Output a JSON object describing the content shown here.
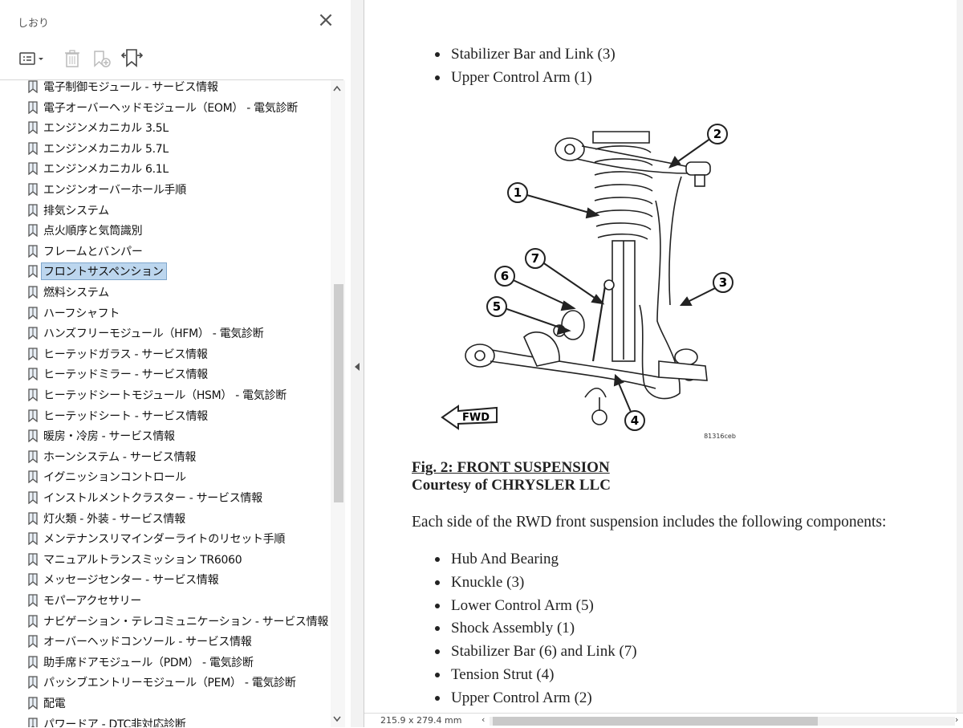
{
  "panel": {
    "title": "しおり",
    "close_icon": "close-icon",
    "toolbar": [
      "options-menu-icon",
      "delete-bookmark-icon",
      "new-bookmark-icon",
      "bookmark-search-icon"
    ],
    "items": [
      {
        "label": "電子制御モジュール - サービス情報",
        "selected": false
      },
      {
        "label": "電子オーバーヘッドモジュール（EOM） - 電気診断",
        "selected": false
      },
      {
        "label": "エンジンメカニカル 3.5L",
        "selected": false
      },
      {
        "label": "エンジンメカニカル 5.7L",
        "selected": false
      },
      {
        "label": "エンジンメカニカル 6.1L",
        "selected": false
      },
      {
        "label": "エンジンオーバーホール手順",
        "selected": false
      },
      {
        "label": "排気システム",
        "selected": false
      },
      {
        "label": "点火順序と気筒識別",
        "selected": false
      },
      {
        "label": "フレームとバンパー",
        "selected": false
      },
      {
        "label": "フロントサスペンション",
        "selected": true
      },
      {
        "label": "燃料システム",
        "selected": false
      },
      {
        "label": "ハーフシャフト",
        "selected": false
      },
      {
        "label": "ハンズフリーモジュール（HFM） - 電気診断",
        "selected": false
      },
      {
        "label": "ヒーテッドガラス - サービス情報",
        "selected": false
      },
      {
        "label": "ヒーテッドミラー - サービス情報",
        "selected": false
      },
      {
        "label": "ヒーテッドシートモジュール（HSM） - 電気診断",
        "selected": false
      },
      {
        "label": "ヒーテッドシート - サービス情報",
        "selected": false
      },
      {
        "label": "暖房・冷房 - サービス情報",
        "selected": false
      },
      {
        "label": "ホーンシステム - サービス情報",
        "selected": false
      },
      {
        "label": "イグニッションコントロール",
        "selected": false
      },
      {
        "label": "インストルメントクラスター - サービス情報",
        "selected": false
      },
      {
        "label": "灯火類 - 外装 - サービス情報",
        "selected": false
      },
      {
        "label": "メンテナンスリマインダーライトのリセット手順",
        "selected": false
      },
      {
        "label": "マニュアルトランスミッション TR6060",
        "selected": false
      },
      {
        "label": "メッセージセンター - サービス情報",
        "selected": false
      },
      {
        "label": "モパーアクセサリー",
        "selected": false
      },
      {
        "label": "ナビゲーション・テレコミュニケーション - サービス情報",
        "selected": false
      },
      {
        "label": "オーバーヘッドコンソール - サービス情報",
        "selected": false
      },
      {
        "label": "助手席ドアモジュール（PDM） - 電気診断",
        "selected": false
      },
      {
        "label": "パッシブエントリーモジュール（PEM） - 電気診断",
        "selected": false
      },
      {
        "label": "配電",
        "selected": false
      },
      {
        "label": "パワードア - DTC非対応診断",
        "selected": false
      }
    ]
  },
  "document": {
    "top_bullets": [
      "Stabilizer Bar and Link (3)",
      "Upper Control Arm (1)"
    ],
    "figure": {
      "callouts": [
        "1",
        "2",
        "3",
        "4",
        "5",
        "6",
        "7"
      ],
      "direction_label": "FWD",
      "code": "81316ceb"
    },
    "figure_title": "Fig. 2: FRONT SUSPENSION",
    "figure_credit": "Courtesy of CHRYSLER LLC",
    "intro": "Each side of the RWD front suspension includes the following components:",
    "components": [
      "Hub And Bearing",
      "Knuckle (3)",
      "Lower Control Arm (5)",
      "Shock Assembly (1)",
      "Stabilizer Bar (6) and Link (7)",
      "Tension Strut (4)",
      "Upper Control Arm (2)"
    ]
  },
  "status": {
    "page_size": "215.9 x 279.4 mm"
  }
}
